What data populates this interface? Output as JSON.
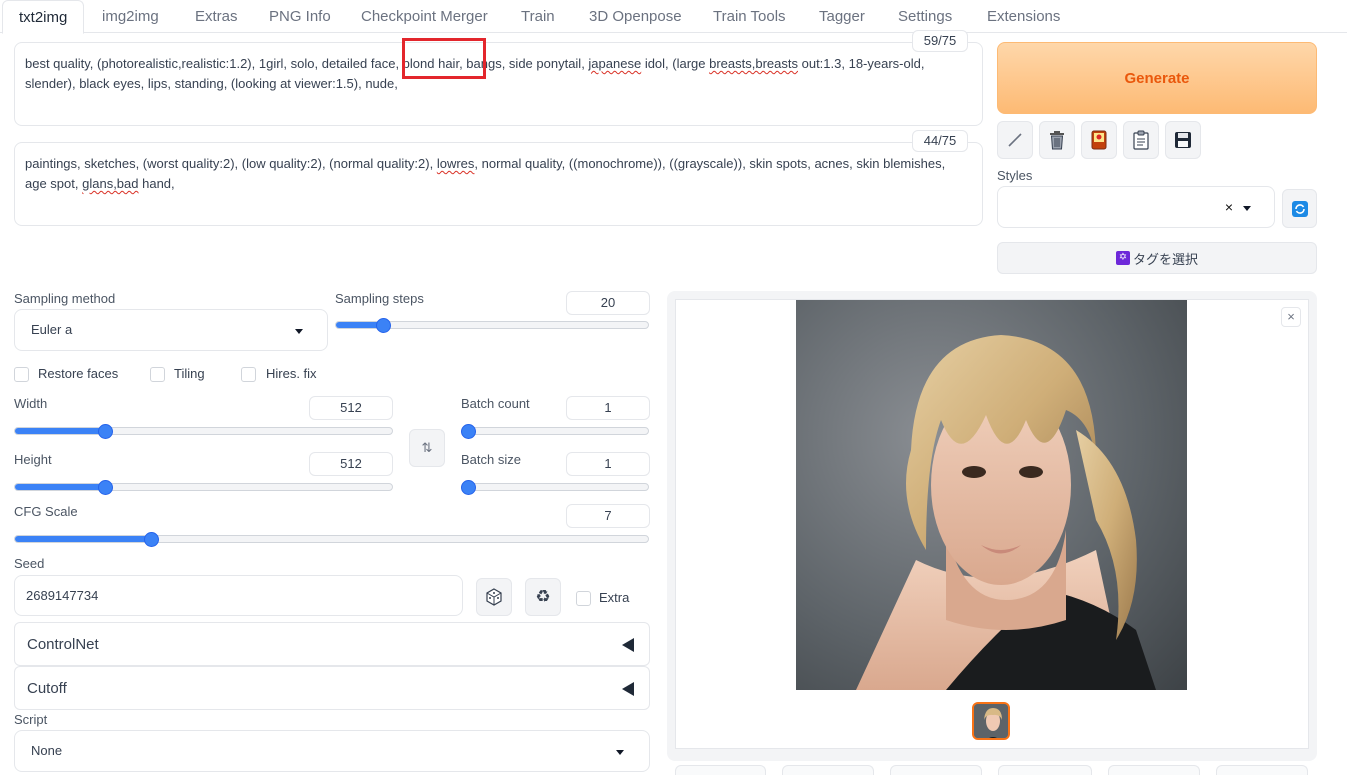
{
  "tabs": [
    "txt2img",
    "img2img",
    "Extras",
    "PNG Info",
    "Checkpoint Merger",
    "Train",
    "3D Openpose",
    "Train Tools",
    "Tagger",
    "Settings",
    "Extensions"
  ],
  "prompt": {
    "line1_before": "best quality, (photorealistic,realistic:1.2), 1girl, solo, detailed face, ",
    "line1_highlight": "blond hair",
    "line1_mid": ", bangs, side ponytail, ",
    "line1_japanese": "japanese",
    "line1_idol": " idol, (large ",
    "line1_breasts": "breasts,breasts",
    "line1_after": " out:1.3, 18-years-old,",
    "line2": "slender), black eyes,  lips,  standing, (looking at viewer:1.5), nude,",
    "token_count": "59/75"
  },
  "negative_prompt": {
    "line1_before": "paintings, sketches, (worst quality:2), (low quality:2), (normal quality:2), ",
    "line1_lowres": "lowres",
    "line1_after": ", normal quality, ((monochrome)), ((grayscale)), skin spots, acnes, skin blemishes,",
    "line2_before": "age spot, ",
    "line2_glans": "glans,bad",
    "line2_after": " hand,",
    "token_count": "44/75"
  },
  "generate_label": "Generate",
  "styles_label": "Styles",
  "tag_select_label": "タグを選択",
  "sampling": {
    "method_label": "Sampling method",
    "method_value": "Euler a",
    "steps_label": "Sampling steps",
    "steps_value": "20",
    "steps_fraction": 0.136
  },
  "checkboxes": {
    "restore_faces": "Restore faces",
    "tiling": "Tiling",
    "hires_fix": "Hires. fix"
  },
  "width": {
    "label": "Width",
    "value": "512",
    "fraction": 0.23
  },
  "height": {
    "label": "Height",
    "value": "512",
    "fraction": 0.23
  },
  "batch_count": {
    "label": "Batch count",
    "value": "1",
    "fraction": 0.0
  },
  "batch_size": {
    "label": "Batch size",
    "value": "1",
    "fraction": 0.0
  },
  "cfg": {
    "label": "CFG Scale",
    "value": "7",
    "fraction": 0.21
  },
  "seed": {
    "label": "Seed",
    "value": "2689147734",
    "extra_label": "Extra"
  },
  "accordions": {
    "controlnet": "ControlNet",
    "cutoff": "Cutoff"
  },
  "script": {
    "label": "Script",
    "value": "None"
  },
  "colors": {
    "accent": "#3b82f6",
    "generate_text": "#ea580c",
    "highlight": "#e3262c"
  }
}
